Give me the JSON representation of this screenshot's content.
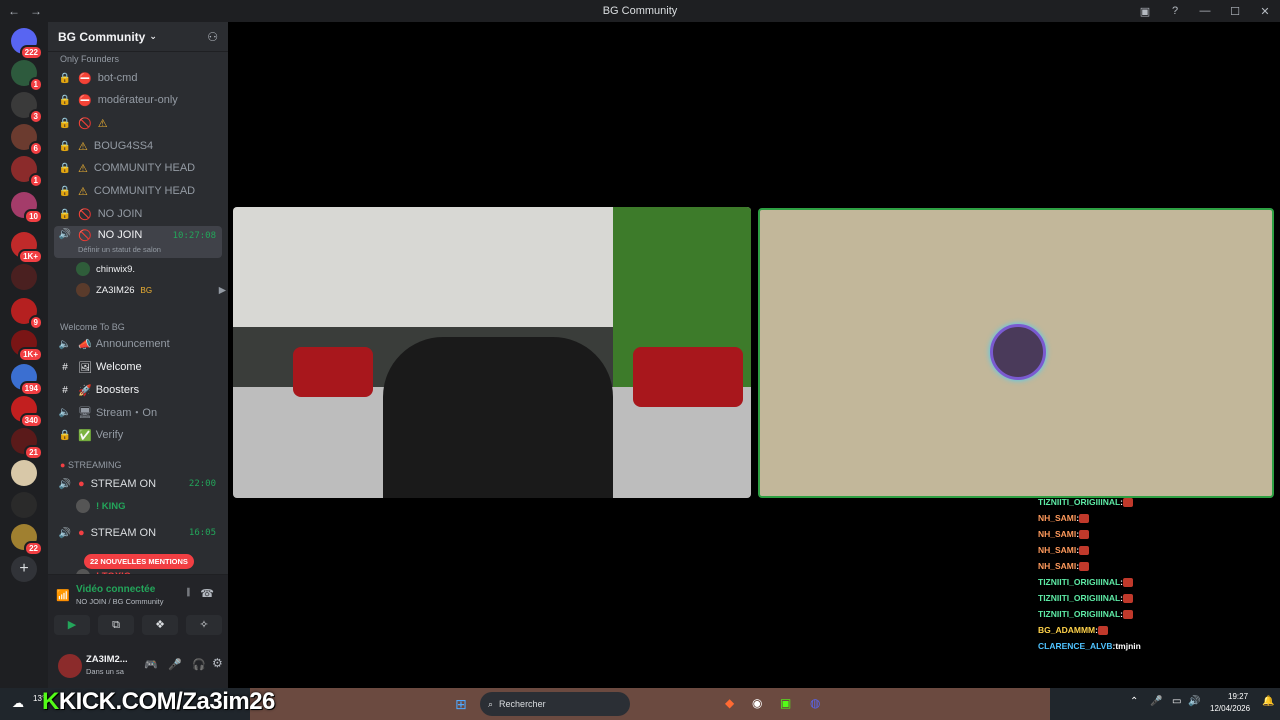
{
  "window": {
    "title": "BG Community"
  },
  "guild": {
    "name": "BG Community"
  },
  "categories": {
    "founders": "Only Founders",
    "welcome": "Welcome To BG",
    "streaming": "STREAMING"
  },
  "channels": [
    {
      "name": "bot-cmd",
      "icon": "no-entry-icon"
    },
    {
      "name": "modérateur-only",
      "icon": "no-entry-icon"
    },
    {
      "name": "",
      "icon": "warning-icon"
    },
    {
      "name": "BOUG4SS4",
      "icon": "warning-icon"
    },
    {
      "name": "COMMUNITY HEAD",
      "icon": "warning-icon"
    },
    {
      "name": "COMMUNITY HEAD",
      "icon": "warning-icon"
    },
    {
      "name": "NO JOIN",
      "icon": "prohibited-icon"
    }
  ],
  "active_voice": {
    "name": "NO JOIN",
    "timer": "10:27:08",
    "status": "Définir un statut de salon",
    "users": [
      "chinwix9.",
      "ZA3IM26"
    ],
    "user_tag": "BG"
  },
  "welcome_channels": [
    "Announcement",
    "Welcome",
    "Boosters",
    "Stream・On",
    "Verify"
  ],
  "stream_channels": [
    {
      "name": "STREAM ON",
      "timer": "22:00",
      "user": "! KING"
    },
    {
      "name": "STREAM ON",
      "timer": "16:05",
      "user": "! TOXIC"
    }
  ],
  "mentions_banner": "22 NOUVELLES MENTIONS",
  "voice_panel": {
    "status": "Vidéo connectée",
    "location": "NO JOIN / BG Community"
  },
  "user_panel": {
    "name": "ZA3IM2...",
    "status": "Dans un sa"
  },
  "server_badges": [
    "222",
    "1",
    "3",
    "6",
    "1",
    "10",
    "1K+",
    "9",
    "1K+",
    "194",
    "340",
    "21",
    "22"
  ],
  "chat": [
    {
      "user": "TIZNIITI_ORIGIIINAL",
      "msg": "",
      "color": "#5eeba6"
    },
    {
      "user": "NH_SAMI",
      "msg": "",
      "color": "#ff9a5c"
    },
    {
      "user": "NH_SAMI",
      "msg": "",
      "color": "#ff9a5c"
    },
    {
      "user": "NH_SAMI",
      "msg": "",
      "color": "#ff9a5c"
    },
    {
      "user": "NH_SAMI",
      "msg": "",
      "color": "#ff9a5c"
    },
    {
      "user": "TIZNIITI_ORIGIIINAL",
      "msg": "",
      "color": "#5eeba6"
    },
    {
      "user": "TIZNIITI_ORIGIIINAL",
      "msg": "",
      "color": "#5eeba6"
    },
    {
      "user": "TIZNIITI_ORIGIIINAL",
      "msg": "",
      "color": "#5eeba6"
    },
    {
      "user": "BG_ADAMMM",
      "msg": "",
      "color": "#ffd24a"
    },
    {
      "user": "CLARENCE_ALVB",
      "msg": "tmjnin",
      "color": "#4fc3ff"
    }
  ],
  "overlay": {
    "kick": "KICK.COM/Za3im26"
  },
  "taskbar": {
    "search": "Rechercher",
    "time": "19:27",
    "date": "12/04/2026",
    "weather": "13°"
  }
}
